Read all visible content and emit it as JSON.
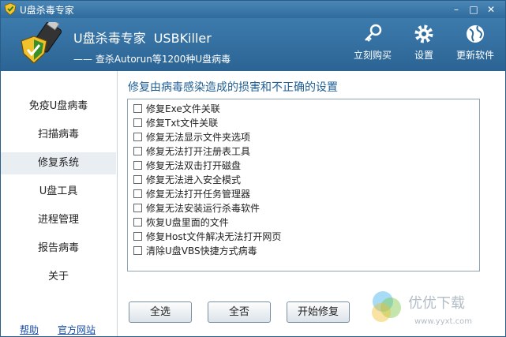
{
  "window": {
    "title": "U盘杀毒专家",
    "minimize": "–",
    "maximize": "□",
    "close": "✕"
  },
  "header": {
    "brand_cn": "U盘杀毒专家",
    "brand_en": "USBKiller",
    "slogan": "—— 查杀Autorun等1200种U盘病毒",
    "tools": [
      {
        "label": "立刻购买",
        "icon": "key-icon"
      },
      {
        "label": "设置",
        "icon": "gear-icon"
      },
      {
        "label": "更新软件",
        "icon": "globe-icon"
      }
    ]
  },
  "sidebar": {
    "items": [
      {
        "label": "免疫U盘病毒",
        "active": false
      },
      {
        "label": "扫描病毒",
        "active": false
      },
      {
        "label": "修复系统",
        "active": true
      },
      {
        "label": "U盘工具",
        "active": false
      },
      {
        "label": "进程管理",
        "active": false
      },
      {
        "label": "报告病毒",
        "active": false
      },
      {
        "label": "关于",
        "active": false
      }
    ],
    "help_link": "帮助",
    "site_link": "官方网站"
  },
  "main": {
    "title": "修复由病毒感染造成的损害和不正确的设置",
    "options": [
      {
        "label": "修复Exe文件关联",
        "checked": false
      },
      {
        "label": "修复Txt文件关联",
        "checked": false
      },
      {
        "label": "修复无法显示文件夹选项",
        "checked": false
      },
      {
        "label": "修复无法打开注册表工具",
        "checked": false
      },
      {
        "label": "修复无法双击打开磁盘",
        "checked": false
      },
      {
        "label": "修复无法进入安全模式",
        "checked": false
      },
      {
        "label": "修复无法打开任务管理器",
        "checked": false
      },
      {
        "label": "修复无法安装运行杀毒软件",
        "checked": false
      },
      {
        "label": "恢复U盘里面的文件",
        "checked": false
      },
      {
        "label": "修复Host文件解决无法打开网页",
        "checked": false
      },
      {
        "label": "清除U盘VBS快捷方式病毒",
        "checked": false
      }
    ],
    "buttons": {
      "select_all": "全选",
      "select_none": "全否",
      "start_repair": "开始修复"
    }
  },
  "watermark": {
    "text": "优优下载",
    "url": "www.yyxt.com"
  },
  "colors": {
    "header": "#2f6b9c",
    "accent": "#1f5f95",
    "link": "#1a4da8"
  }
}
